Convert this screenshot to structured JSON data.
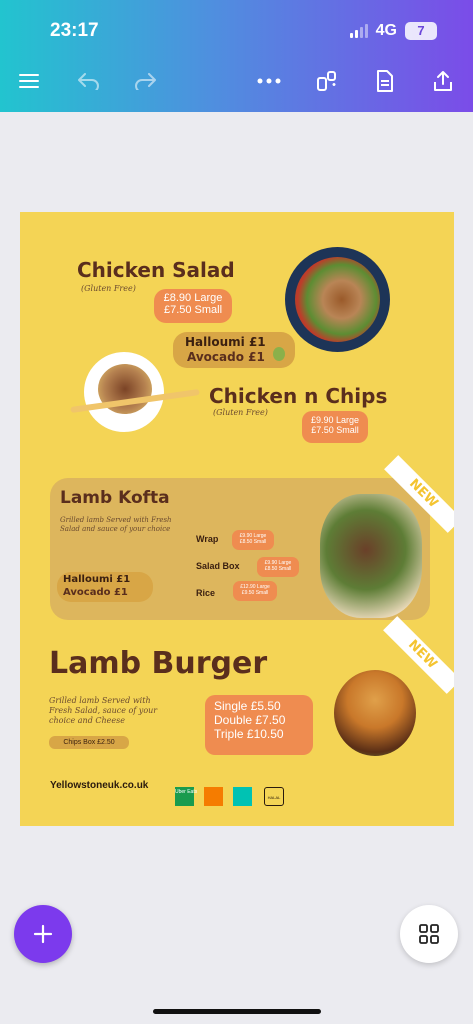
{
  "status": {
    "time": "23:17",
    "network": "4G",
    "battery": "7"
  },
  "toolbar": {
    "menu_icon": "hamburger-icon",
    "undo_icon": "undo-icon",
    "redo_icon": "redo-icon",
    "more_icon": "more-icon",
    "resize_icon": "magic-resize-icon",
    "notes_icon": "document-icon",
    "share_icon": "share-icon"
  },
  "menu": {
    "chicken_salad": {
      "title": "Chicken Salad",
      "subtitle": "(Gluten Free)",
      "price_large": "£8.90 Large",
      "price_small": "£7.50 Small"
    },
    "extras_1": {
      "halloumi": "Halloumi £1",
      "avocado": "Avocado £1"
    },
    "chicken_chips": {
      "title": "Chicken n Chips",
      "subtitle": "(Gluten Free)",
      "price_large": "£9.90 Large",
      "price_small": "£7.50 Small"
    },
    "lamb_kofta": {
      "title": "Lamb Kofta",
      "description_1": "Grilled lamb Served with Fresh",
      "description_2": "Salad and sauce of your choice",
      "options": [
        {
          "name": "Wrap",
          "large": "£9.90 Large",
          "small": "£8.50 Small"
        },
        {
          "name": "Salad Box",
          "large": "£9.90 Large",
          "small": "£8.50 Small"
        },
        {
          "name": "Rice",
          "large": "£12.90 Large",
          "small": "£9.50 Small"
        }
      ],
      "halloumi": "Halloumi £1",
      "avocado": "Avocado £1",
      "badge": "NEW"
    },
    "lamb_burger": {
      "title": "Lamb Burger",
      "description_1": "Grilled lamb Served with",
      "description_2": "Fresh Salad, sauce of your",
      "description_3": "choice and Cheese",
      "chips_box": "Chips Box £2.50",
      "single": "Single £5.50",
      "double": "Double £7.50",
      "triple": "Triple £10.50",
      "badge": "NEW"
    },
    "website": "Yellowstoneuk.co.uk",
    "delivery": {
      "uber": "Uber Eats",
      "halal": "HALAL"
    }
  },
  "controls": {
    "add_icon": "plus-icon",
    "pages_icon": "grid-icon"
  }
}
